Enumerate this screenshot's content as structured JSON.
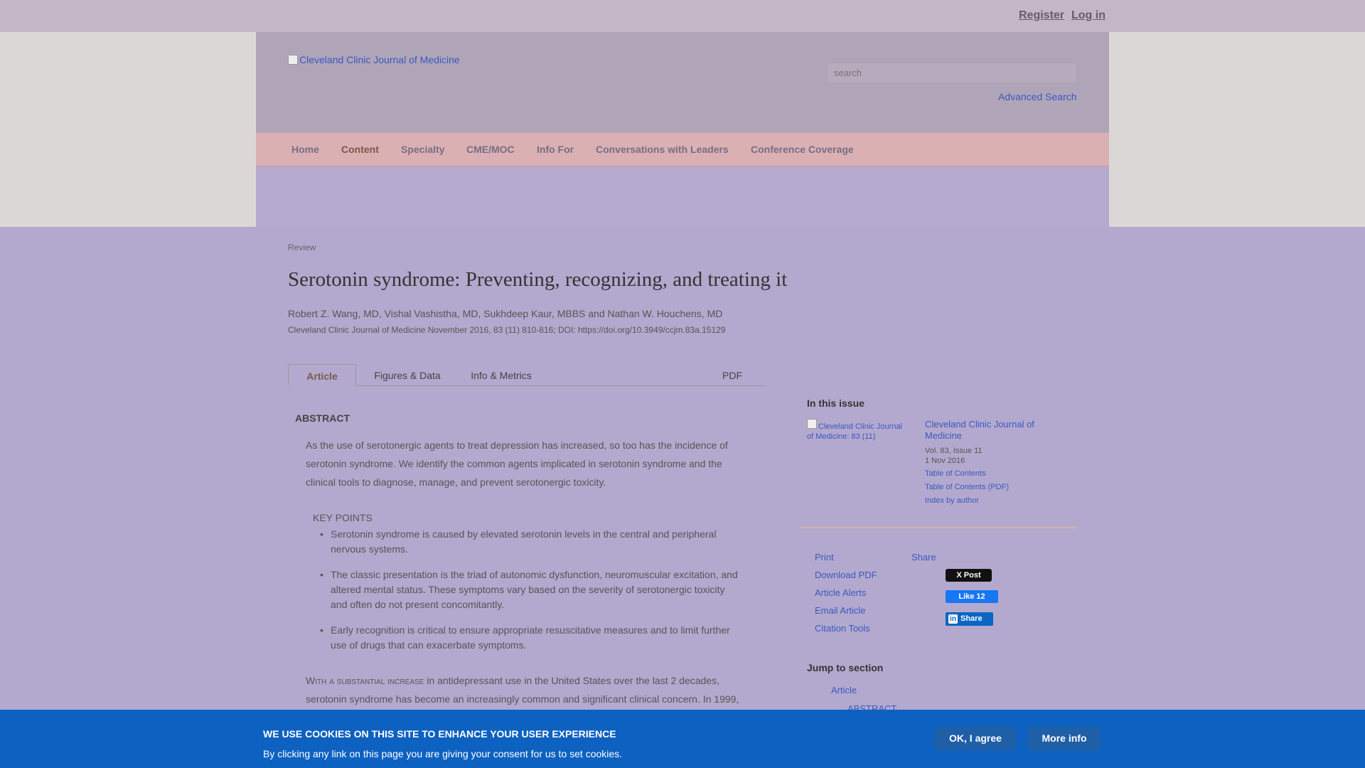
{
  "topbar": {
    "menu_glyph": "",
    "register": "Register",
    "login": "Log in"
  },
  "header": {
    "logo_alt": "Cleveland Clinic Journal of Medicine",
    "search_placeholder": "search",
    "advanced_search": "Advanced Search"
  },
  "nav": {
    "items": [
      "Home",
      "Content",
      "Specialty",
      "CME/MOC",
      "Info For",
      "Conversations with Leaders",
      "Conference Coverage"
    ],
    "active": "Content"
  },
  "article": {
    "type": "Review",
    "title": "Serotonin syndrome: Preventing, recognizing, and treating it",
    "authors": "Robert Z. Wang, MD, Vishal Vashistha, MD, Sukhdeep Kaur, MBBS and Nathan W. Houchens, MD",
    "citation": "Cleveland Clinic Journal of Medicine November 2016, 83 (11) 810-816; DOI: https://doi.org/10.3949/ccjm.83a.15129",
    "tabs": [
      "Article",
      "Figures & Data",
      "Info & Metrics"
    ],
    "pdf_label": " PDF",
    "abstract_heading": "ABSTRACT",
    "abstract_text": "As the use of serotonergic agents to treat depression has increased, so too has the incidence of serotonin syndrome. We identify the common agents implicated in serotonin syndrome and the clinical tools to diagnose, manage, and prevent serotonergic toxicity.",
    "key_points_heading": "KEY POINTS",
    "key_points": [
      "Serotonin syndrome is caused by elevated serotonin levels in the central and peripheral nervous systems.",
      "The classic presentation is the triad of autonomic dysfunction, neuromuscular excitation, and altered mental status. These symptoms vary based on the severity of serotonergic toxicity and often do not present concomitantly.",
      "Early recognition is critical to ensure appropriate resuscitative measures and to limit further use of drugs that can exacerbate symptoms."
    ],
    "body_lead": "With a substantial increase",
    "body_rest": " in antidepressant use in the United States over the last 2 decades, serotonin syndrome has become an increasingly common and significant clinical concern. In 1999,"
  },
  "sidebar": {
    "in_this_issue": "In this issue",
    "cover_alt": "Cleveland Clinic Journal of Medicine: 83 (11)",
    "journal_title": "Cleveland Clinic Journal of Medicine",
    "volume": "Vol. 83, Issue 11",
    "date": "1 Nov 2016",
    "issue_links": [
      "Table of Contents",
      "Table of Contents (PDF)",
      "Index by author"
    ],
    "tools": [
      "Print",
      "Download PDF",
      "Article Alerts",
      "Email Article",
      "Citation Tools"
    ],
    "share": "Share",
    "x_post": "X Post",
    "fb_like": "Like 12",
    "li_share": "Share",
    "jump_heading": "Jump to section",
    "jump_items": [
      "Article",
      "ABSTRACT"
    ]
  },
  "cookie": {
    "heading": "WE USE COOKIES ON THIS SITE TO ENHANCE YOUR USER EXPERIENCE",
    "text": "By clicking any link on this page you are giving your consent for us to set cookies.",
    "agree": "OK, I agree",
    "more": "More info"
  }
}
